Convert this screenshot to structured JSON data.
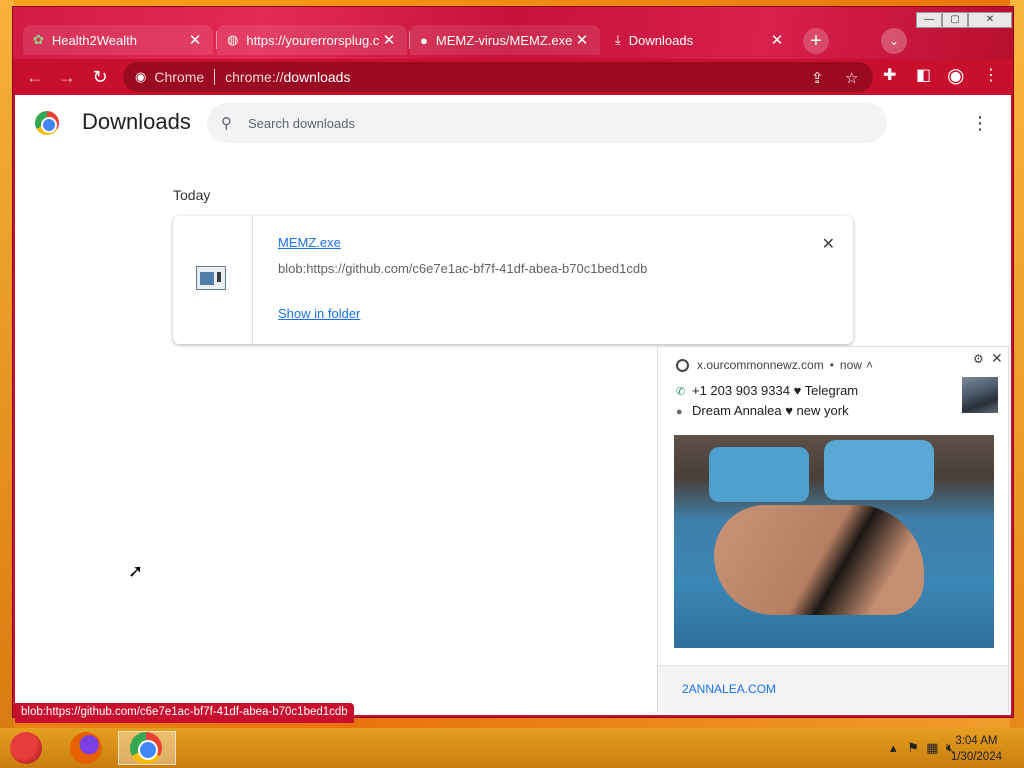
{
  "tabs": [
    {
      "title": "Health2Wealth",
      "icon": "health2wealth-favicon"
    },
    {
      "title": "https://yourerrorsplug.c",
      "icon": "globe-icon"
    },
    {
      "title": "MEMZ-virus/MEMZ.exe",
      "icon": "github-icon"
    },
    {
      "title": "Downloads",
      "icon": "download-icon",
      "active": true
    }
  ],
  "omnibox": {
    "chip": "Chrome",
    "url_prefix": "chrome://",
    "url_host": "downloads"
  },
  "page": {
    "title": "Downloads",
    "search_placeholder": "Search downloads",
    "section_label": "Today"
  },
  "download": {
    "filename": "MEMZ.exe",
    "source": "blob:https://github.com/c6e7e1ac-bf7f-41df-abea-b70c1bed1cdb",
    "action": "Show in folder"
  },
  "status_bar": "blob:https://github.com/c6e7e1ac-bf7f-41df-abea-b70c1bed1cdb",
  "notification": {
    "source": "x.ourcommonnewz.com",
    "time": "now",
    "line1": "+1 203 903 9334 ♥ Telegram",
    "line2": "Dream Annalea ♥ new york",
    "footer_link": "2ANNALEA.COM"
  },
  "clock": {
    "time": "3:04 AM",
    "date": "1/30/2024"
  },
  "colors": {
    "frame": "#c8102e",
    "link": "#1a73e8",
    "taskbar": "#e5a020"
  }
}
